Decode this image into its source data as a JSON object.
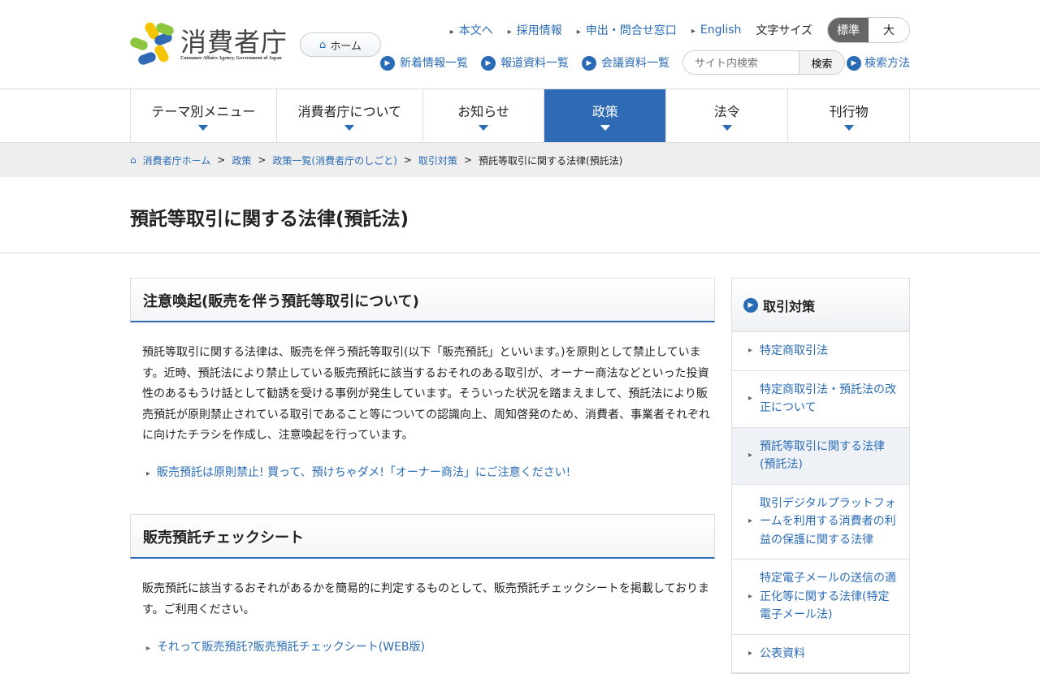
{
  "header": {
    "logo_text": "消費者庁",
    "logo_sub": "Consumer Affairs Agency, Government of Japan",
    "home": "ホーム",
    "top_links": [
      "本文へ",
      "採用情報",
      "申出・問合せ窓口",
      "English"
    ],
    "font_size_label": "文字サイズ",
    "font_sizes": [
      "標準",
      "大"
    ],
    "sub_links": [
      "新着情報一覧",
      "報道資料一覧",
      "会議資料一覧"
    ],
    "search_placeholder": "サイト内検索",
    "search_button": "検索",
    "search_help": "検索方法"
  },
  "nav": [
    "テーマ別メニュー",
    "消費者庁について",
    "お知らせ",
    "政策",
    "法令",
    "刊行物"
  ],
  "breadcrumb": [
    "消費者庁ホーム",
    "政策",
    "政策一覧(消費者庁のしごと)",
    "取引対策",
    "預託等取引に関する法律(預託法)"
  ],
  "page_title": "預託等取引に関する法律(預託法)",
  "sections": [
    {
      "heading": "注意喚起(販売を伴う預託等取引について)",
      "body": "預託等取引に関する法律は、販売を伴う預託等取引(以下「販売預託」といいます。)を原則として禁止しています。近時、預託法により禁止している販売預託に該当するおそれのある取引が、オーナー商法などといった投資性のあるもうけ話として勧誘を受ける事例が発生しています。そういった状況を踏まえまして、預託法により販売預託が原則禁止されている取引であること等についての認識向上、周知啓発のため、消費者、事業者それぞれに向けたチラシを作成し、注意喚起を行っています。",
      "link": "販売預託は原則禁止! 買って、預けちゃダメ!「オーナー商法」にご注意ください!"
    },
    {
      "heading": "販売預託チェックシート",
      "body": "販売預託に該当するおそれがあるかを簡易的に判定するものとして、販売預託チェックシートを掲載しております。ご利用ください。",
      "link": "それって販売預託?販売預託チェックシート(WEB版)"
    }
  ],
  "sidebar": {
    "heading": "取引対策",
    "items": [
      "特定商取引法",
      "特定商取引法・預託法の改正について",
      "預託等取引に関する法律(預託法)",
      "取引デジタルプラットフォームを利用する消費者の利益の保護に関する法律",
      "特定電子メールの送信の適正化等に関する法律(特定電子メール法)",
      "公表資料"
    ]
  }
}
